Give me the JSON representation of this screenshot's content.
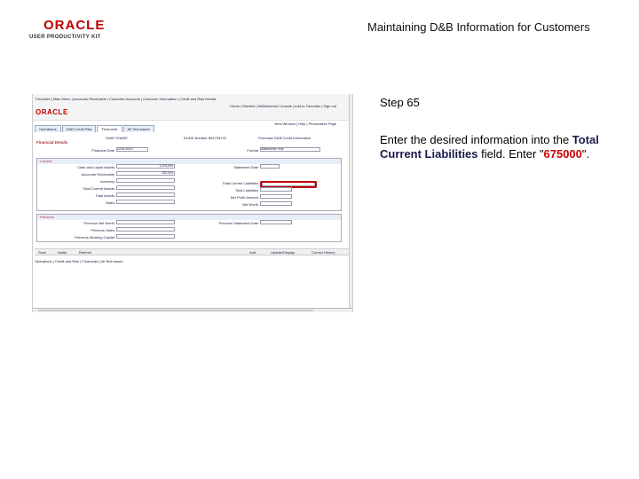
{
  "logo": {
    "word": "ORACLE",
    "sub": "USER PRODUCTIVITY KIT"
  },
  "doc_title": "Maintaining D&B Information for Customers",
  "step": "Step 65",
  "instruction": {
    "pre": "Enter the desired information into the ",
    "field": "Total Current Liabilities",
    "mid": " field. Enter \"",
    "value": "675000",
    "post": "\"."
  },
  "app": {
    "crumb": "Favorites | Main Menu | Accounts Receivable | Customer Accounts | Customer Information | Credit and Risk Details",
    "toplinks": "Home | Worklist | Multichannel Console | Add to Favorites | Sign out",
    "brand": "ORACLE",
    "navlinks": "New Window | Help | Personalize Page",
    "tabs": [
      "Operations",
      "D&B Credit Risk",
      "Financials",
      "All Text-based"
    ],
    "header": {
      "setid": "SetID SHARE",
      "duns": "DUNS Number 804735132",
      "purchase": "Purchase D&B Credit Information",
      "fin_date_label": "Financial Date",
      "fin_date": "12/31/2010",
      "format_label": "Format",
      "format": "Statements Year"
    },
    "sections": {
      "financial": "Financial Details",
      "current": "Current",
      "previous": "Previous"
    },
    "fields_left": [
      {
        "label": "Cash and Liquid Assets",
        "value": "1,475,000"
      },
      {
        "label": "Accounts Receivable",
        "value": "230,000"
      },
      {
        "label": "Inventory",
        "value": ""
      },
      {
        "label": "Total Current Assets",
        "value": ""
      },
      {
        "label": "Total Assets",
        "value": ""
      },
      {
        "label": "Sales",
        "value": ""
      }
    ],
    "fields_right": [
      {
        "label": "Statement Date",
        "value": ""
      },
      {
        "label": "Total Current Liabilities",
        "value": ""
      },
      {
        "label": "Total Liabilities",
        "value": ""
      },
      {
        "label": "Net Profit Amount",
        "value": ""
      },
      {
        "label": "Net Worth",
        "value": ""
      }
    ],
    "prev_left": [
      {
        "label": "Previous Net Worth",
        "value": ""
      },
      {
        "label": "Previous Sales",
        "value": ""
      },
      {
        "label": "Previous Working Capital",
        "value": ""
      }
    ],
    "prev_right": [
      {
        "label": "Previous Statement Date",
        "value": ""
      }
    ],
    "buttons": {
      "save": "Save",
      "notify": "Notify",
      "refresh": "Refresh",
      "add": "Add",
      "update": "Update/Display",
      "correct": "Correct History"
    },
    "footer": "Operations | Credit and Risk | Financials | All Text-based"
  }
}
